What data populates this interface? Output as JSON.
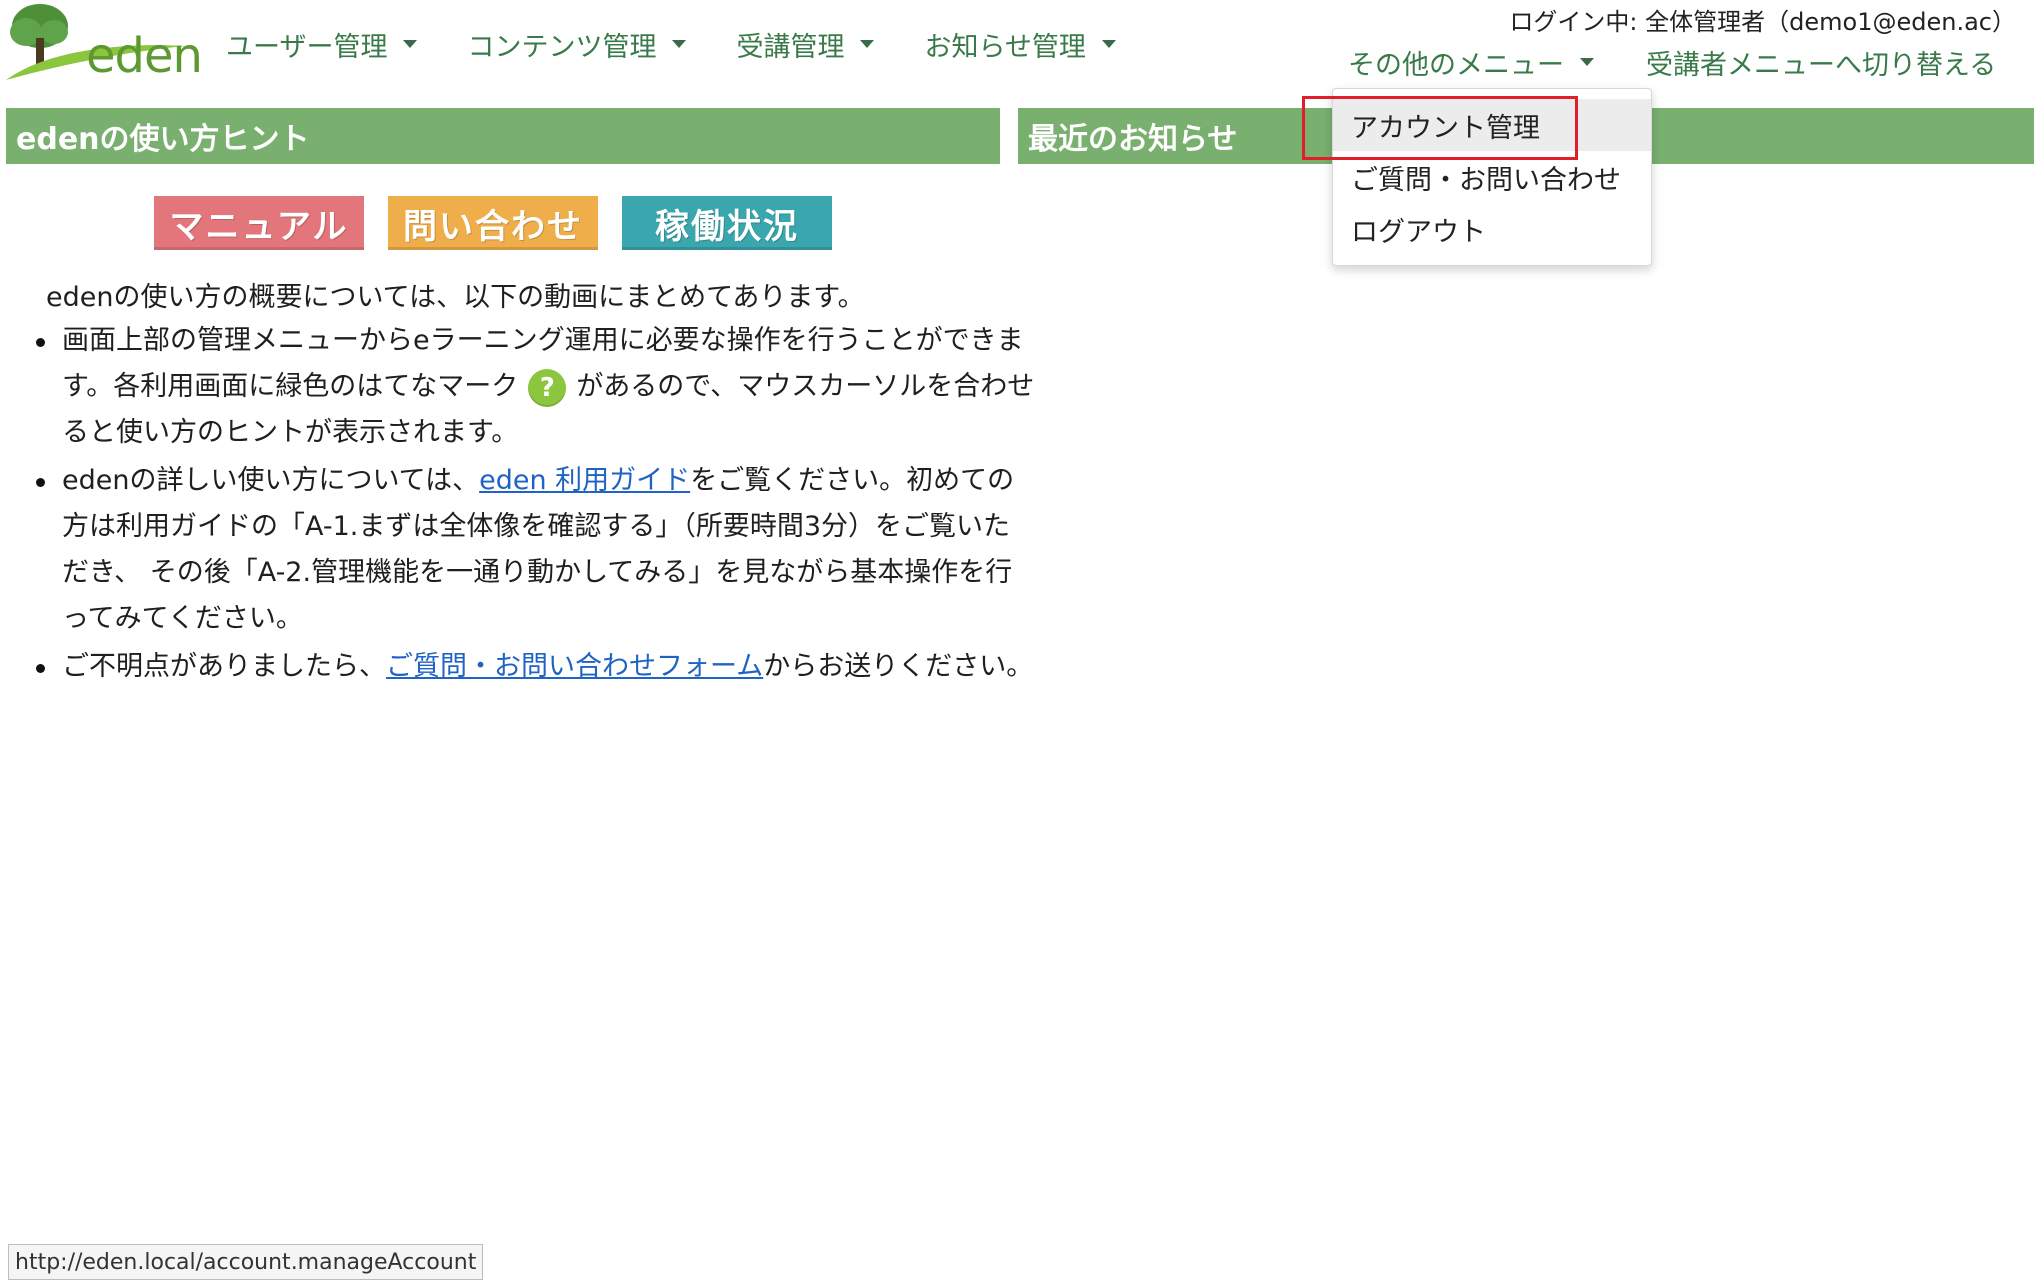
{
  "brand": {
    "logo_text": "eden"
  },
  "nav": {
    "items": [
      {
        "label": "ユーザー管理"
      },
      {
        "label": "コンテンツ管理"
      },
      {
        "label": "受講管理"
      },
      {
        "label": "お知らせ管理"
      }
    ]
  },
  "header": {
    "login_info": "ログイン中: 全体管理者（demo1@eden.ac）",
    "other_menu_label": "その他のメニュー",
    "switch_label": "受講者メニューへ切り替える"
  },
  "dropdown": {
    "items": [
      {
        "label": "アカウント管理"
      },
      {
        "label": "ご質問・お問い合わせ"
      },
      {
        "label": "ログアウト"
      }
    ]
  },
  "left_panel": {
    "title": "edenの使い方ヒント",
    "buttons": [
      {
        "label": "マニュアル",
        "color": "#e3767b"
      },
      {
        "label": "問い合わせ",
        "color": "#f0ae4a"
      },
      {
        "label": "稼働状況",
        "color": "#3aa6ad"
      }
    ],
    "intro": "edenの使い方の概要については、以下の動画にまとめてあります。",
    "bullets": {
      "b1_part1": "画面上部の管理メニューからeラーニング運用に必要な操作を行うことができます。各利用画面に緑色のはてなマーク",
      "b1_icon": "?",
      "b1_part2": "があるので、マウスカーソルを合わせると使い方のヒントが表示されます。",
      "b2_part1": "edenの詳しい使い方については、",
      "b2_link": "eden 利用ガイド",
      "b2_part2": "をご覧ください。初めての方は利用ガイドの「A-1.まずは全体像を確認する」（所要時間3分）をご覧いただき、 その後「A-2.管理機能を一通り動かしてみる」を見ながら基本操作を行ってみてください。",
      "b3_part1": "ご不明点がありましたら、",
      "b3_link": "ご質問・お問い合わせフォーム",
      "b3_part2": "からお送りください。"
    }
  },
  "right_panel": {
    "title": "最近のお知らせ"
  },
  "status_bar": {
    "url": "http://eden.local/account.manageAccount"
  },
  "colors": {
    "accent_green": "#79b06f",
    "nav_text": "#3a7a4a",
    "link": "#1f63c4",
    "highlight": "#e01f2b"
  }
}
